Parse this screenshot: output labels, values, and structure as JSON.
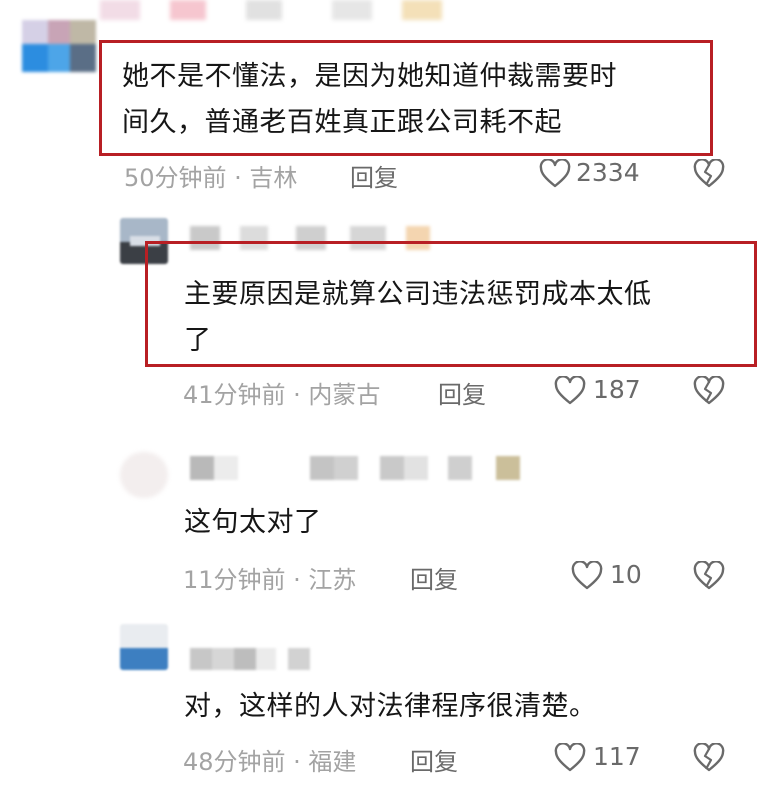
{
  "comments": [
    {
      "text": "她不是不懂法，是因为她知道仲裁需要时\n间久，普通老百姓真正跟公司耗不起",
      "time_location": "50分钟前 · 吉林",
      "reply_label": "回复",
      "like_count": "2334",
      "highlighted": true
    },
    {
      "text": "主要原因是就算公司违法惩罚成本太低\n了",
      "time_location": "41分钟前 · 内蒙古",
      "reply_label": "回复",
      "like_count": "187",
      "highlighted": true
    },
    {
      "text": "这句太对了",
      "time_location": "11分钟前 · 江苏",
      "reply_label": "回复",
      "like_count": "10",
      "highlighted": false
    },
    {
      "text": "对，这样的人对法律程序很清楚。",
      "time_location": "48分钟前 · 福建",
      "reply_label": "回复",
      "like_count": "117",
      "highlighted": false
    }
  ],
  "colors": {
    "highlight_border": "#b81f24",
    "meta_text": "#a3a3a3",
    "action_text": "#6a6a6a"
  },
  "icons": {
    "like": "heart-outline-icon",
    "dislike": "broken-heart-icon"
  }
}
